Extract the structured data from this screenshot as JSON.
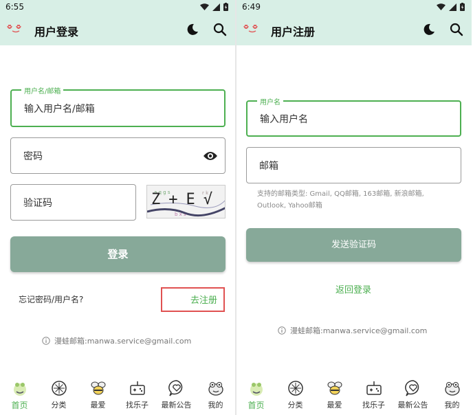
{
  "login": {
    "status_time": "6:55",
    "title": "用户登录",
    "username_legend": "用户名/邮箱",
    "username_value": "输入用户名/邮箱",
    "password_value": "密码",
    "captcha_value": "验证码",
    "captcha_text": "Z+E√",
    "login_button": "登录",
    "forgot_link": "忘记密码/用户名?",
    "register_link": "去注册",
    "contact": "漫蛙邮箱:manwa.service@gmail.com"
  },
  "register": {
    "status_time": "6:49",
    "title": "用户注册",
    "username_legend": "用户名",
    "username_value": "输入用户名",
    "email_value": "邮箱",
    "email_hint": "支持的邮箱类型: Gmail, QQ邮箱, 163邮箱, 新浪邮箱, Outlook, Yahoo邮箱",
    "send_code_button": "发送验证码",
    "back_login_link": "返回登录",
    "contact": "漫蛙邮箱:manwa.service@gmail.com"
  },
  "bottom_nav": [
    {
      "label": "首页",
      "icon": "home-frog-icon"
    },
    {
      "label": "分类",
      "icon": "category-icon"
    },
    {
      "label": "最爱",
      "icon": "favorite-bee-icon"
    },
    {
      "label": "找乐子",
      "icon": "game-controller-icon"
    },
    {
      "label": "最新公告",
      "icon": "announcement-heart-icon"
    },
    {
      "label": "我的",
      "icon": "profile-frog-icon"
    }
  ],
  "colors": {
    "appbar": "#d8efe6",
    "accent_green": "#4caf50",
    "button": "#87a999",
    "highlight": "#e05050"
  }
}
